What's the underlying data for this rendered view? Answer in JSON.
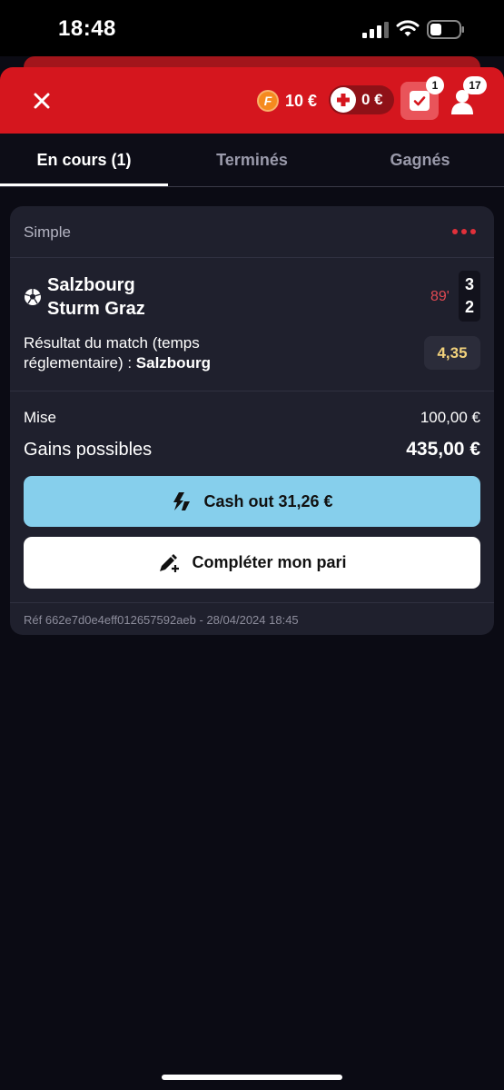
{
  "status_bar": {
    "time": "18:48"
  },
  "header": {
    "freebet_amount": "10 €",
    "freebet_icon_letter": "F",
    "bonus_amount": "0 €",
    "bets_badge": "1",
    "account_badge": "17"
  },
  "tabs": [
    {
      "label": "En cours (1)",
      "active": true
    },
    {
      "label": "Terminés",
      "active": false
    },
    {
      "label": "Gagnés",
      "active": false
    }
  ],
  "bet": {
    "type": "Simple",
    "home_team": "Salzbourg",
    "away_team": "Sturm Graz",
    "minute": "89'",
    "home_score": "3",
    "away_score": "2",
    "market_text": "Résultat du match (temps réglementaire) : ",
    "selection": "Salzbourg",
    "odds": "4,35",
    "stake_label": "Mise",
    "stake_value": "100,00 €",
    "gains_label": "Gains possibles",
    "gains_value": "435,00 €",
    "cashout_label": "Cash out 31,26 €",
    "complete_label": "Compléter mon pari",
    "reference": "Réf 662e7d0e4eff012657592aeb - 28/04/2024 18:45"
  },
  "colors": {
    "brand_red": "#d5161e",
    "cashout_blue": "#86cfec",
    "odds_yellow": "#f2d27c",
    "live_minute_red": "#e14952"
  }
}
